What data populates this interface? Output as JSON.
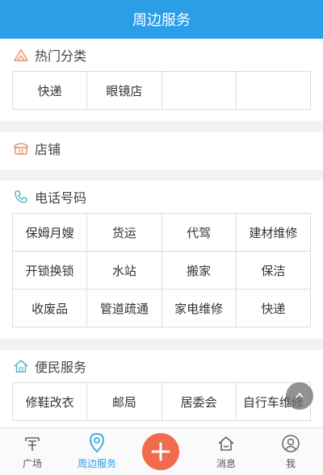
{
  "header": {
    "title": "周边服务"
  },
  "sections": {
    "hot": {
      "title": "热门分类",
      "items": [
        "快递",
        "眼镜店",
        "",
        ""
      ]
    },
    "shops": {
      "title": "店铺"
    },
    "phone": {
      "title": "电话号码",
      "items": [
        "保姆月嫂",
        "货运",
        "代驾",
        "建材维修",
        "开锁换锁",
        "水站",
        "搬家",
        "保洁",
        "收废品",
        "管道疏通",
        "家电维修",
        "快递"
      ]
    },
    "civic": {
      "title": "便民服务",
      "items": [
        "修鞋改衣",
        "邮局",
        "居委会",
        "自行车维修"
      ]
    }
  },
  "tabbar": {
    "plaza": "广场",
    "nearby": "周边服务",
    "messages": "消息",
    "me": "我"
  },
  "colors": {
    "accent": "#2a9ee6",
    "fab": "#f26b4f",
    "icon": "#e5966a",
    "civic_icon": "#5bb8c4"
  }
}
